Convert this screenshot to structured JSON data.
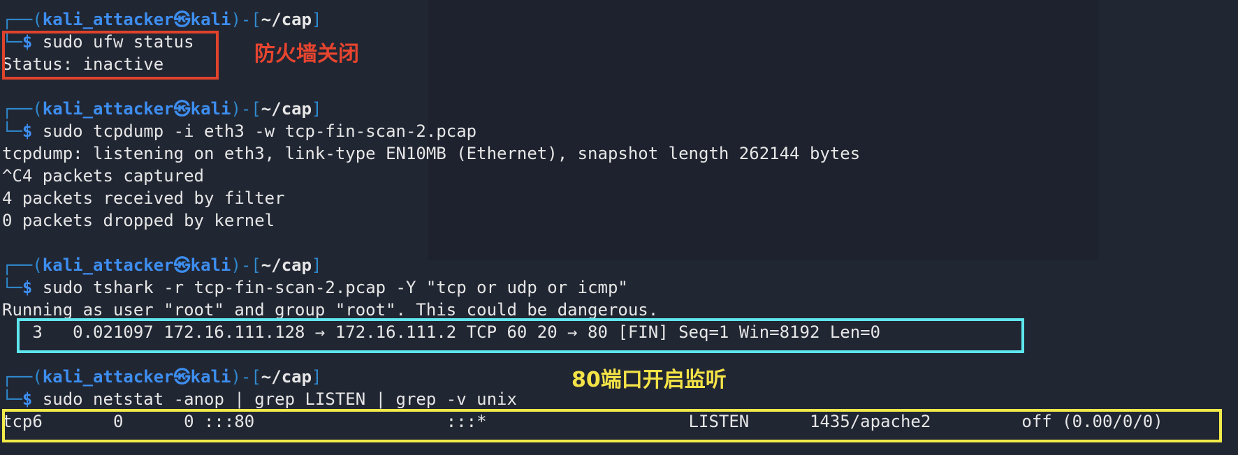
{
  "prompt": {
    "frame_top": "┌──(",
    "user": "kali_attacker",
    "at_symbol": "㉿",
    "host": "kali",
    "mid": ")-[",
    "path": "~/cap",
    "close": "]",
    "frame_bottom": "└─",
    "dollar": "$"
  },
  "blocks": [
    {
      "command": "sudo ufw status",
      "output": [
        "Status: inactive"
      ]
    },
    {
      "command": "sudo tcpdump -i eth3 -w tcp-fin-scan-2.pcap",
      "output": [
        "tcpdump: listening on eth3, link-type EN10MB (Ethernet), snapshot length 262144 bytes",
        "^C4 packets captured",
        "4 packets received by filter",
        "0 packets dropped by kernel"
      ]
    },
    {
      "command": "sudo tshark -r tcp-fin-scan-2.pcap -Y \"tcp or udp or icmp\"",
      "output": [
        "Running as user \"root\" and group \"root\". This could be dangerous.",
        "   3   0.021097 172.16.111.128 → 172.16.111.2 TCP 60 20 → 80 [FIN] Seq=1 Win=8192 Len=0"
      ]
    },
    {
      "command": "sudo netstat -anop | grep LISTEN | grep -v unix",
      "output": [
        "tcp6       0      0 :::80                   :::*                    LISTEN      1435/apache2         off (0.00/0/0)"
      ]
    }
  ],
  "annotations": {
    "firewall_note": "防火墙关闭",
    "port_note": "80端口开启监听"
  },
  "colors": {
    "background": "#212633",
    "prompt_blue": "#3d8ef0",
    "red_box": "#e0432c",
    "cyan_box": "#5ee6ee",
    "yellow_box": "#f2ea4a"
  }
}
